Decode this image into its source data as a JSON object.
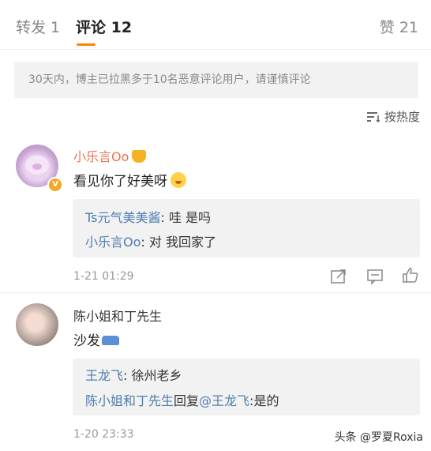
{
  "tabs": {
    "repost": "转发 1",
    "comment": "评论 12",
    "like": "赞 21"
  },
  "notice": "30天内，博主已拉黑多于10名恶意评论用户，请谨慎评论",
  "sort_label": "按热度",
  "comments": [
    {
      "user": "小乐言Oo",
      "text": "看见你了好美呀",
      "replies": [
        {
          "user": "Ts元气美美酱",
          "text": ": 哇 是吗"
        },
        {
          "user": "小乐言Oo",
          "text": ": 对 我回家了"
        }
      ],
      "time": "1-21 01:29"
    },
    {
      "user": "陈小姐和丁先生",
      "text": "沙发",
      "replies": [
        {
          "user": "王龙飞",
          "text": ": 徐州老乡"
        },
        {
          "user": "陈小姐和丁先生",
          "mid": "回复",
          "target": "@王龙飞",
          "text": ":是的"
        }
      ],
      "time": "1-20 23:33"
    }
  ],
  "watermark": "头条 @罗夏Roxia",
  "colors": {
    "accent": "#ff8200",
    "username": "#eb7350",
    "link": "#507daf"
  }
}
